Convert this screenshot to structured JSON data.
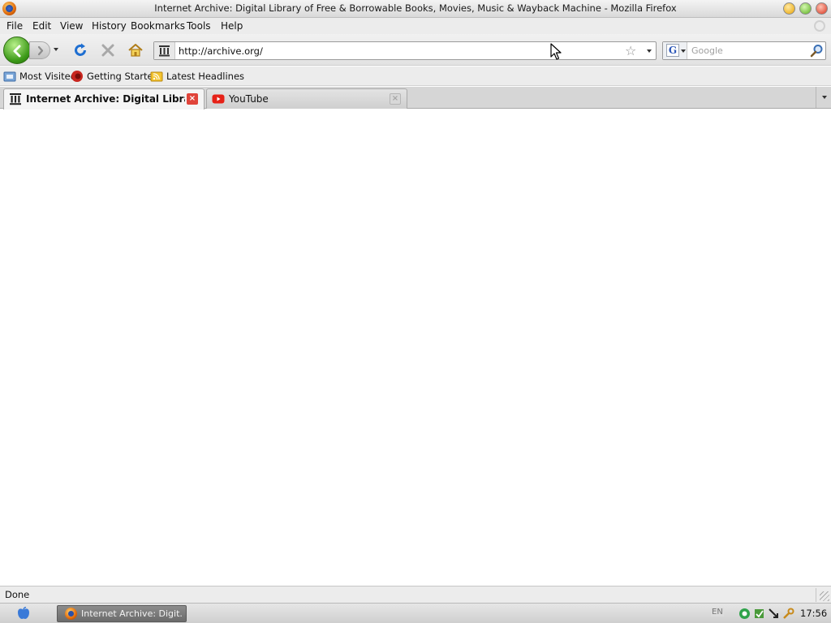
{
  "window": {
    "title": "Internet Archive: Digital Library of Free & Borrowable Books, Movies, Music & Wayback Machine - Mozilla Firefox"
  },
  "menu": [
    "File",
    "Edit",
    "View",
    "History",
    "Bookmarks",
    "Tools",
    "Help"
  ],
  "nav": {
    "url": "http://archive.org/",
    "search_placeholder": "Google"
  },
  "bookmarks": [
    "Most Visited",
    "Getting Started",
    "Latest Headlines"
  ],
  "tabs": [
    {
      "label": "Internet Archive: Digital Library o..."
    },
    {
      "label": "YouTube"
    }
  ],
  "status": {
    "text": "Done"
  },
  "taskbar": {
    "task_label": "Internet Archive: Digit...",
    "lang": "EN",
    "clock": "17:56"
  },
  "colors": {
    "back_button": "#3c9a18",
    "reload": "#1f6fd1",
    "youtube_red": "#e62117",
    "tab_close": "#e0443a"
  }
}
